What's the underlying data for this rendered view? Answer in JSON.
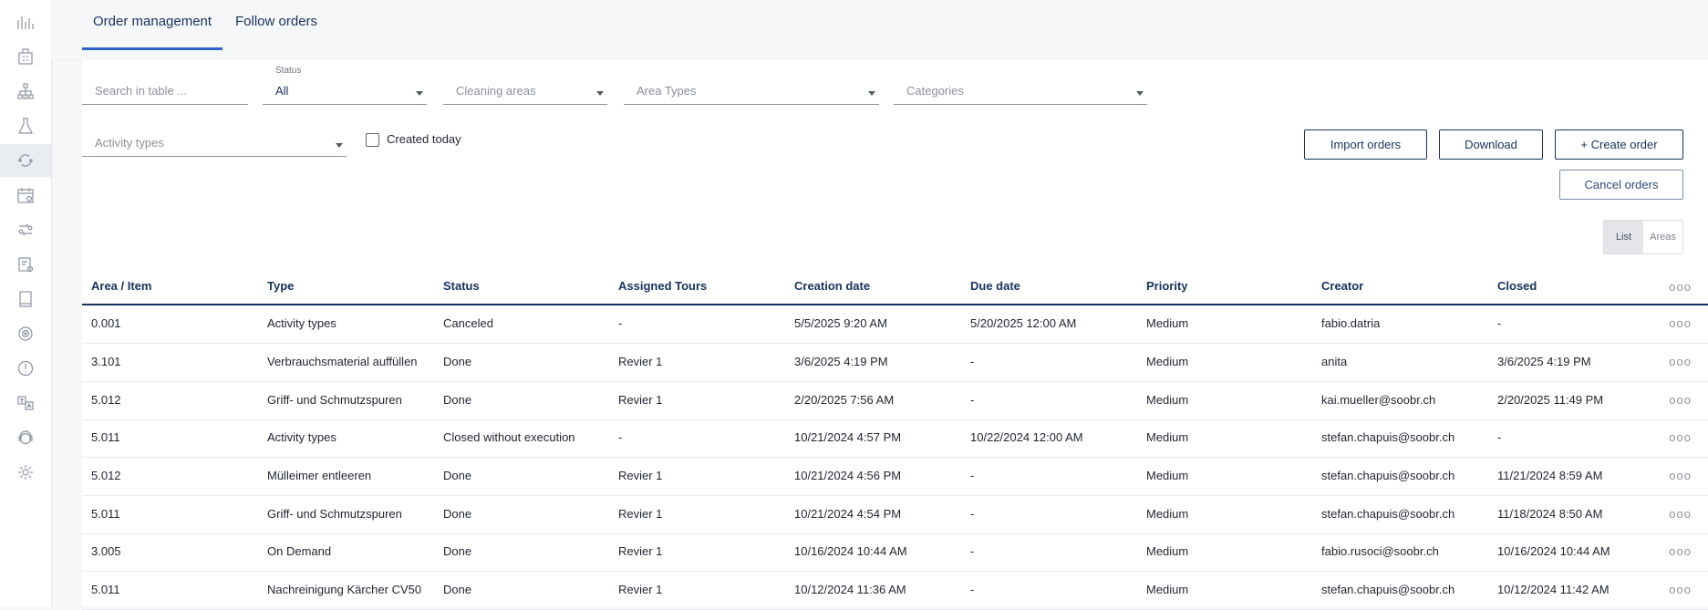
{
  "tabs": [
    {
      "label": "Order management"
    },
    {
      "label": "Follow orders"
    }
  ],
  "sidebar": {
    "icons": [
      "analytics-icon",
      "building-icon",
      "hierarchy-icon",
      "lab-flask-icon",
      "refresh-orders-icon",
      "calendar-icon",
      "transfer-users-icon",
      "document-settings-icon",
      "book-icon",
      "target-icon",
      "alert-icon",
      "translate-icon",
      "support-icon",
      "gear-icon"
    ]
  },
  "filters": {
    "search_placeholder": "Search in table ...",
    "status_label": "Status",
    "status_value": "All",
    "cleaning_areas": "Cleaning areas",
    "area_types": "Area Types",
    "categories": "Categories",
    "activity_types": "Activity types",
    "created_today": "Created today"
  },
  "actions": {
    "import": "Import orders",
    "download": "Download",
    "create": "+ Create order",
    "cancel": "Cancel orders"
  },
  "view_toggle": {
    "list": "List",
    "areas": "Areas"
  },
  "table": {
    "columns": [
      "Area / Item",
      "Type",
      "Status",
      "Assigned Tours",
      "Creation date",
      "Due date",
      "Priority",
      "Creator",
      "Closed"
    ],
    "rows": [
      [
        "0.001",
        "Activity types",
        "Canceled",
        "-",
        "5/5/2025 9:20 AM",
        "5/20/2025 12:00 AM",
        "Medium",
        "fabio.datria",
        "-"
      ],
      [
        "3.101",
        "Verbrauchsmaterial auffüllen",
        "Done",
        "Revier 1",
        "3/6/2025 4:19 PM",
        "-",
        "Medium",
        "anita",
        "3/6/2025 4:19 PM"
      ],
      [
        "5.012",
        "Griff- und Schmutzspuren",
        "Done",
        "Revier 1",
        "2/20/2025 7:56 AM",
        "-",
        "Medium",
        "kai.mueller@soobr.ch",
        "2/20/2025 11:49 PM"
      ],
      [
        "5.011",
        "Activity types",
        "Closed without execution",
        "-",
        "10/21/2024 4:57 PM",
        "10/22/2024 12:00 AM",
        "Medium",
        "stefan.chapuis@soobr.ch",
        "-"
      ],
      [
        "5.012",
        "Mülleimer entleeren",
        "Done",
        "Revier 1",
        "10/21/2024 4:56 PM",
        "-",
        "Medium",
        "stefan.chapuis@soobr.ch",
        "11/21/2024 8:59 AM"
      ],
      [
        "5.011",
        "Griff- und Schmutzspuren",
        "Done",
        "Revier 1",
        "10/21/2024 4:54 PM",
        "-",
        "Medium",
        "stefan.chapuis@soobr.ch",
        "11/18/2024 8:50 AM"
      ],
      [
        "3.005",
        "On Demand",
        "Done",
        "Revier 1",
        "10/16/2024 10:44 AM",
        "-",
        "Medium",
        "fabio.rusoci@soobr.ch",
        "10/16/2024 10:44 AM"
      ],
      [
        "5.011",
        "Nachreinigung Kärcher CV50",
        "Done",
        "Revier 1",
        "10/12/2024 11:36 AM",
        "-",
        "Medium",
        "stefan.chapuis@soobr.ch",
        "10/12/2024 11:42 AM"
      ]
    ],
    "row_menu": "ooo"
  }
}
